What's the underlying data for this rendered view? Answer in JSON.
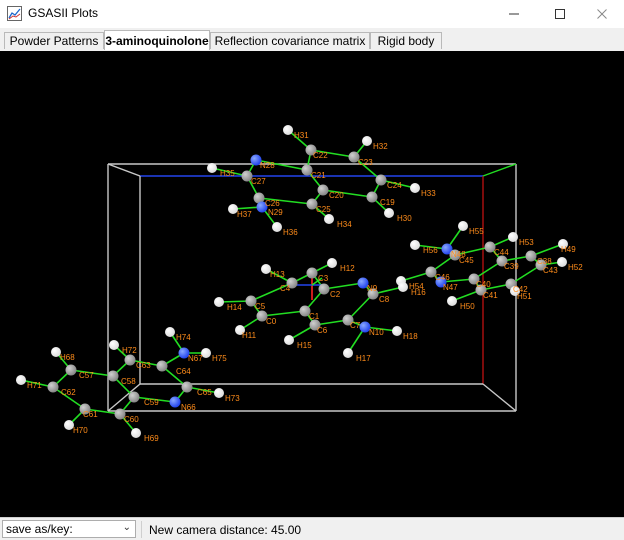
{
  "window": {
    "title": "GSASII Plots",
    "minimize_icon": "minimize-icon",
    "maximize_icon": "maximize-icon",
    "close_icon": "close-icon"
  },
  "tabs": [
    {
      "label": "Powder Patterns",
      "active": false
    },
    {
      "label": "3-aminoquinolone",
      "active": true
    },
    {
      "label": "Reflection covariance matrix",
      "active": false
    },
    {
      "label": "Rigid body",
      "active": false
    }
  ],
  "status": {
    "select_value": "save as/key:",
    "message": "New camera distance: 45.00"
  },
  "colors": {
    "background": "#000000",
    "bond": "#22dd22",
    "carbon": "#888888",
    "hydrogen": "#dddddd",
    "nitrogen": "#2244ee",
    "label": "#ff8c1a",
    "cell_edge": "#c8c8c8",
    "axis_a": "#ff2222",
    "axis_b": "#22dd22",
    "axis_c": "#2244ee"
  },
  "atoms": {
    "H31": "H31",
    "H32": "H32",
    "C22": "C22",
    "C23": "C23",
    "N28": "N28",
    "H35": "H35",
    "C27": "C27",
    "C21": "C21",
    "C24": "C24",
    "H33": "H33",
    "C20": "C20",
    "C26": "C26",
    "C25": "C25",
    "C19": "C19",
    "H37": "H37",
    "N29": "N29",
    "H34": "H34",
    "H30": "H30",
    "H36": "H36",
    "H55": "H55",
    "H56": "H56",
    "N48": "N48",
    "C45": "C45",
    "C44": "C44",
    "H53": "H53",
    "H49": "H49",
    "C39": "C39",
    "C38": "C38",
    "C43": "C43",
    "H52": "H52",
    "C46": "C46",
    "N47": "N47",
    "C40": "C40",
    "C41": "C41",
    "C42": "C42",
    "H51": "H51",
    "H50": "H50",
    "H54": "H54",
    "H16": "H16",
    "H12": "H12",
    "H13": "H13",
    "C3": "C3",
    "C4": "C4",
    "C2": "C2",
    "N9": "N9",
    "C8": "C8",
    "C5": "C5",
    "H14": "H14",
    "C0": "C0",
    "C1": "C1",
    "C7": "C7",
    "H11": "H11",
    "C6": "C6",
    "N10": "N10",
    "H18": "H18",
    "H15": "H15",
    "H17": "H17",
    "H74": "H74",
    "H72": "H72",
    "N67": "N67",
    "H75": "H75",
    "C63": "C63",
    "C64": "C64",
    "H68": "H68",
    "C57": "C57",
    "C58": "C58",
    "C65": "C65",
    "H73": "H73",
    "H71": "H71",
    "C62": "C62",
    "C59": "C59",
    "N66": "N66",
    "C61": "C61",
    "C60": "C60",
    "H70": "H70",
    "H69": "H69"
  }
}
